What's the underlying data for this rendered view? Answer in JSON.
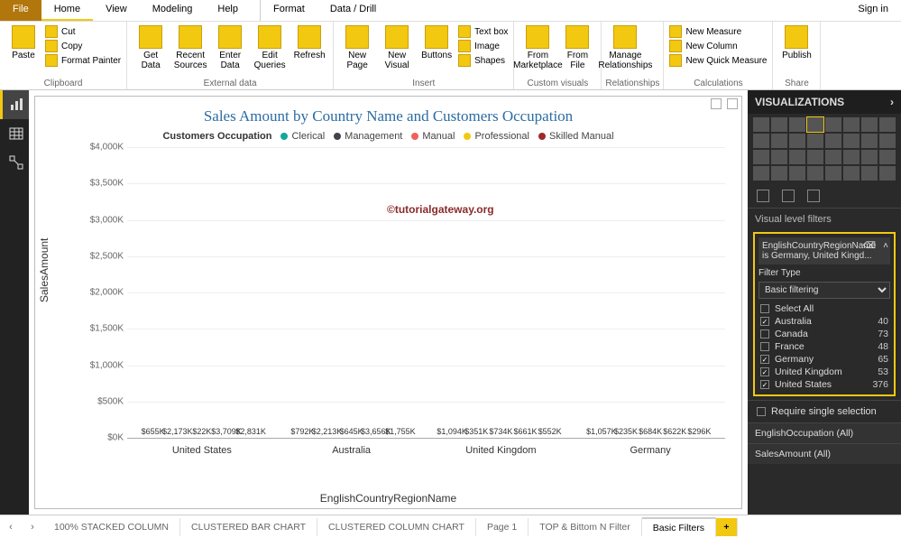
{
  "menubar": {
    "file": "File",
    "home": "Home",
    "view": "View",
    "modeling": "Modeling",
    "help": "Help",
    "format": "Format",
    "datadrill": "Data / Drill",
    "signin": "Sign in"
  },
  "ribbon": {
    "clipboard": {
      "label": "Clipboard",
      "paste": "Paste",
      "cut": "Cut",
      "copy": "Copy",
      "fmt": "Format Painter"
    },
    "external": {
      "label": "External data",
      "getdata": "Get Data",
      "recent": "Recent Sources",
      "enter": "Enter Data",
      "edit": "Edit Queries",
      "refresh": "Refresh"
    },
    "insert": {
      "label": "Insert",
      "newpage": "New Page",
      "newvisual": "New Visual",
      "buttons": "Buttons",
      "textbox": "Text box",
      "image": "Image",
      "shapes": "Shapes"
    },
    "custom": {
      "label": "Custom visuals",
      "marketplace": "From Marketplace",
      "file": "From File"
    },
    "relationships": {
      "label": "Relationships",
      "manage": "Manage Relationships"
    },
    "calculations": {
      "label": "Calculations",
      "measure": "New Measure",
      "column": "New Column",
      "quick": "New Quick Measure"
    },
    "share": {
      "label": "Share",
      "publish": "Publish"
    }
  },
  "chart_data": {
    "type": "bar",
    "title": "Sales Amount by Country Name and Customers Occupation",
    "legend_title": "Customers Occupation",
    "ylabel": "SalesAmount",
    "xlabel": "EnglishCountryRegionName",
    "ylim": [
      0,
      4000
    ],
    "yticks": [
      "$0K",
      "$500K",
      "$1,000K",
      "$1,500K",
      "$2,000K",
      "$2,500K",
      "$3,000K",
      "$3,500K",
      "$4,000K"
    ],
    "categories": [
      "United States",
      "Australia",
      "United Kingdom",
      "Germany"
    ],
    "series": [
      {
        "name": "Clerical",
        "color": "#14a79d",
        "values": [
          655,
          792,
          1094,
          1057
        ]
      },
      {
        "name": "Management",
        "color": "#40444a",
        "values": [
          2173,
          2213,
          351,
          235
        ]
      },
      {
        "name": "Manual",
        "color": "#f0615e",
        "values": [
          22,
          645,
          734,
          684
        ]
      },
      {
        "name": "Professional",
        "color": "#f2c811",
        "values": [
          3709,
          3656,
          661,
          622
        ]
      },
      {
        "name": "Skilled Manual",
        "color": "#9c2b2b",
        "values": [
          2831,
          1755,
          552,
          296
        ]
      }
    ],
    "labels": [
      [
        "$655K",
        "$2,173K",
        "$22K",
        "$3,709K",
        "$2,831K"
      ],
      [
        "$792K",
        "$2,213K",
        "$645K",
        "$3,656K",
        "$1,755K"
      ],
      [
        "$1,094K",
        "$351K",
        "$734K",
        "$661K",
        "$552K"
      ],
      [
        "$1,057K",
        "$235K",
        "$684K",
        "$622K",
        "$296K"
      ]
    ],
    "watermark": "©tutorialgateway.org"
  },
  "viz_pane": {
    "header": "VISUALIZATIONS",
    "section": "Visual level filters",
    "filter": {
      "field": "EnglishCountryRegionName",
      "summary": "is Germany, United Kingd...",
      "type_label": "Filter Type",
      "type_value": "Basic filtering",
      "items": [
        {
          "label": "Select All",
          "count": "",
          "checked": false
        },
        {
          "label": "Australia",
          "count": "40",
          "checked": true
        },
        {
          "label": "Canada",
          "count": "73",
          "checked": false
        },
        {
          "label": "France",
          "count": "48",
          "checked": false
        },
        {
          "label": "Germany",
          "count": "65",
          "checked": true
        },
        {
          "label": "United Kingdom",
          "count": "53",
          "checked": true
        },
        {
          "label": "United States",
          "count": "376",
          "checked": true
        }
      ],
      "require_single": "Require single selection"
    },
    "other_filters": [
      "EnglishOccupation  (All)",
      "SalesAmount  (All)"
    ]
  },
  "page_tabs": [
    "100% STACKED COLUMN",
    "CLUSTERED BAR CHART",
    "CLUSTERED COLUMN CHART",
    "Page 1",
    "TOP & Bittom N Filter",
    "Basic Filters"
  ]
}
